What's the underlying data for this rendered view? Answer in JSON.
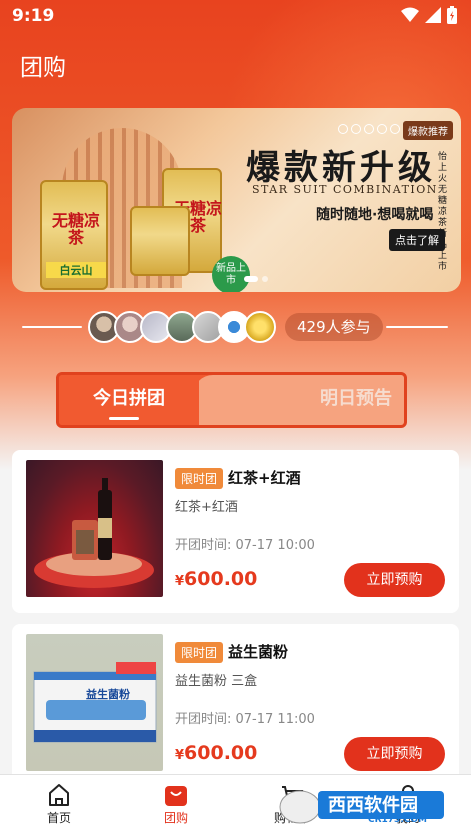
{
  "status_bar": {
    "time": "9:19"
  },
  "header": {
    "title": "团购"
  },
  "banner": {
    "tag": "爆款推荐",
    "headline": "爆款新升级",
    "subheadline": "STAR SUIT COMBINATION",
    "slogan": "随时随地·想喝就喝",
    "cta_label": "点击了解",
    "side_text": "怡上火 无糖凉茶 新品上市",
    "can_text": "无糖凉茶",
    "can_brand": "白云山",
    "new_badge": "新品上市"
  },
  "participants": {
    "count_label": "429人参与"
  },
  "tabs": [
    {
      "label": "今日拼团",
      "active": true
    },
    {
      "label": "明日预告",
      "active": false
    }
  ],
  "products": [
    {
      "tag": "限时团",
      "name": "红茶+红酒",
      "desc": "红茶+红酒",
      "time": "开团时间: 07-17 10:00",
      "price_symbol": "¥",
      "price": "600.00",
      "button_label": "立即预购"
    },
    {
      "tag": "限时团",
      "name": "益生菌粉",
      "desc": "益生菌粉 三盒",
      "time": "开团时间: 07-17 11:00",
      "price_symbol": "¥",
      "price": "600.00",
      "button_label": "立即预购",
      "box_text": "益生菌粉"
    }
  ],
  "bottom_nav": [
    {
      "label": "首页",
      "icon": "home-icon"
    },
    {
      "label": "团购",
      "icon": "shopping-bag-icon",
      "active": true
    },
    {
      "label": "购物车",
      "icon": "cart-icon"
    },
    {
      "label": "我的",
      "icon": "person-icon"
    }
  ],
  "watermark": {
    "text": "西西软件园",
    "domain": "CR173.COM"
  },
  "colors": {
    "primary": "#e2321c",
    "tag": "#f08a3a",
    "hero": "#e8431f"
  }
}
